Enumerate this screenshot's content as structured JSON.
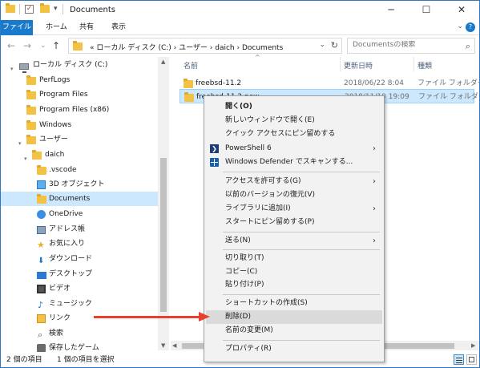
{
  "window": {
    "title": "Documents",
    "minimize_glyph": "─",
    "maximize_glyph": "☐",
    "close_glyph": "✕"
  },
  "quick_access": {
    "dropdown_glyph": "▾"
  },
  "ribbon": {
    "tabs": [
      "ファイル",
      "ホーム",
      "共有",
      "表示"
    ],
    "expand_glyph": "⌄",
    "help_glyph": "?"
  },
  "navigation": {
    "back_glyph": "←",
    "forward_glyph": "→",
    "recent_glyph": "⌄",
    "up_glyph": "↑",
    "address_path": "«  ローカル ディスク (C:)  ›  ユーザー  ›  daich  ›  Documents",
    "address_dropdown_glyph": "⌄",
    "refresh_glyph": "↻",
    "search_placeholder": "Documentsの検索",
    "search_glyph": "⌕"
  },
  "nav_pane": {
    "items": [
      {
        "label": "ローカル ディスク (C:)",
        "icon": "drive-icon"
      },
      {
        "label": "PerfLogs",
        "icon": "folder-icon"
      },
      {
        "label": "Program Files",
        "icon": "folder-icon"
      },
      {
        "label": "Program Files (x86)",
        "icon": "folder-icon"
      },
      {
        "label": "Windows",
        "icon": "folder-icon"
      },
      {
        "label": "ユーザー",
        "icon": "folder-icon"
      },
      {
        "label": "daich",
        "icon": "folder-icon"
      },
      {
        "label": ".vscode",
        "icon": "folder-icon"
      },
      {
        "label": "3D オブジェクト",
        "icon": "cube-icon"
      },
      {
        "label": "Documents",
        "icon": "folder-icon"
      },
      {
        "label": "OneDrive",
        "icon": "onedrive-icon"
      },
      {
        "label": "アドレス帳",
        "icon": "contacts-icon"
      },
      {
        "label": "お気に入り",
        "icon": "star-icon"
      },
      {
        "label": "ダウンロード",
        "icon": "download-icon"
      },
      {
        "label": "デスクトップ",
        "icon": "desktop-icon"
      },
      {
        "label": "ビデオ",
        "icon": "video-icon"
      },
      {
        "label": "ミュージック",
        "icon": "music-icon"
      },
      {
        "label": "リンク",
        "icon": "link-icon"
      },
      {
        "label": "検索",
        "icon": "search-icon"
      },
      {
        "label": "保存したゲーム",
        "icon": "game-icon"
      }
    ],
    "selected": "Documents"
  },
  "file_list": {
    "columns": [
      "名前",
      "更新日時",
      "種類"
    ],
    "sort_glyph": "^",
    "rows": [
      {
        "name": "freebsd-11.2",
        "modified": "2018/06/22 8:04",
        "type": "ファイル フォルダー"
      },
      {
        "name": "freebsd-11.2.new",
        "modified": "2018/11/10 19:09",
        "type": "ファイル フォルダー"
      }
    ],
    "selected_row": "freebsd-11.2.new"
  },
  "context_menu": {
    "items": [
      {
        "label": "開く(O)",
        "bold": true
      },
      {
        "label": "新しいウィンドウで開く(E)"
      },
      {
        "label": "クイック アクセスにピン留めする"
      },
      {
        "label": "PowerShell 6",
        "submenu": true,
        "icon": "powershell-icon"
      },
      {
        "label": "Windows Defender でスキャンする...",
        "icon": "windows-defender-icon"
      },
      {
        "label": "アクセスを許可する(G)",
        "submenu": true
      },
      {
        "label": "以前のバージョンの復元(V)"
      },
      {
        "label": "ライブラリに追加(I)",
        "submenu": true
      },
      {
        "label": "スタートにピン留めする(P)"
      },
      {
        "label": "送る(N)",
        "submenu": true
      },
      {
        "label": "切り取り(T)"
      },
      {
        "label": "コピー(C)"
      },
      {
        "label": "貼り付け(P)"
      },
      {
        "label": "ショートカットの作成(S)"
      },
      {
        "label": "削除(D)",
        "hover": true
      },
      {
        "label": "名前の変更(M)"
      },
      {
        "label": "プロパティ(R)"
      }
    ],
    "submenu_glyph": "›",
    "powershell_glyph": "❯"
  },
  "status_bar": {
    "item_count": "2 個の項目",
    "selection": "1 個の項目を選択"
  },
  "colors": {
    "accent": "#1979ca",
    "selection": "#cce8ff",
    "folder": "#f3c244",
    "annotation_arrow": "#e8402b"
  }
}
